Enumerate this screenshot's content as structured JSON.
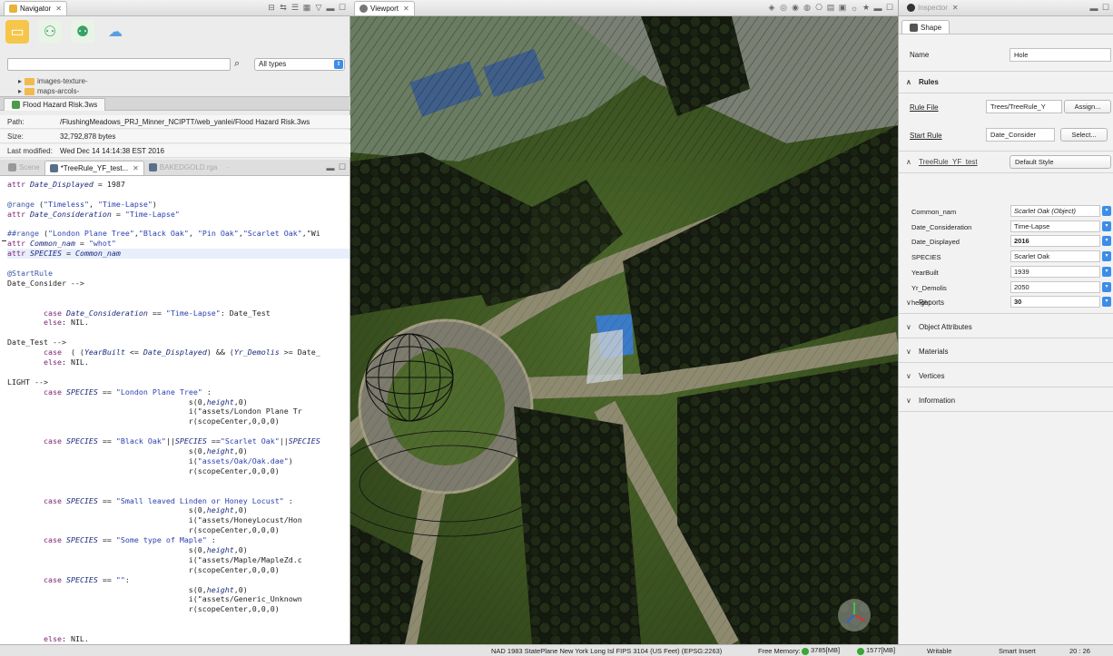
{
  "navigator": {
    "tab_label": "Navigator",
    "search_placeholder": "",
    "type_filter": "All types",
    "tree": [
      "images-texture-",
      "maps-arcols-"
    ],
    "file_tab": "Flood Hazard Risk.3ws",
    "properties": [
      {
        "key": "Path:",
        "value": "/FlushingMeadows_PRJ_Minner_NCIPTT/web_yanlei/Flood Hazard Risk.3ws"
      },
      {
        "key": "Size:",
        "value": "32,792,878 bytes"
      },
      {
        "key": "Last modified:",
        "value": "Wed Dec 14 14:14:38 EST 2016"
      }
    ]
  },
  "editor": {
    "tabs": [
      "Scene",
      "*TreeRule_YF_test...",
      "BAKEDGOLD.rga",
      "-"
    ]
  },
  "viewport": {
    "tab_label": "Viewport"
  },
  "inspector": {
    "tab_label": "Inspector",
    "shape_tab": "Shape",
    "name_label": "Name",
    "name_value": "Hole",
    "rules_section": "Rules",
    "rule_file_label": "Rule File",
    "rule_file_value": "Trees/TreeRule_Y",
    "assign_button": "Assign...",
    "start_rule_label": "Start Rule",
    "start_rule_value": "Date_Consider",
    "select_button": "Select...",
    "style_section": "TreeRule_YF_test",
    "style_value": "Default Style",
    "attributes": [
      {
        "key": "Common_nam",
        "value": "Scarlet Oak (Object)"
      },
      {
        "key": "Date_Consideration",
        "value": "Time-Lapse"
      },
      {
        "key": "Date_Displayed",
        "value": "2016"
      },
      {
        "key": "SPECIES",
        "value": "Scarlet Oak"
      },
      {
        "key": "YearBuilt",
        "value": "1939"
      },
      {
        "key": "Yr_Demolis",
        "value": "2050"
      },
      {
        "key": "height",
        "value": "30"
      }
    ],
    "collapsed_sections": [
      "Reports",
      "Object Attributes",
      "Materials",
      "Vertices",
      "Information"
    ]
  },
  "statusbar": {
    "projection": "NAD 1983 StatePlane New York Long Isl FIPS 3104 (US Feet) (EPSG:2263)",
    "free_memory_label": "Free Memory:",
    "mem1": "3785[MB]",
    "mem2": "1577[MB]",
    "writable": "Writable",
    "insert_mode": "Smart Insert",
    "cursor_pos": "20 : 26"
  }
}
